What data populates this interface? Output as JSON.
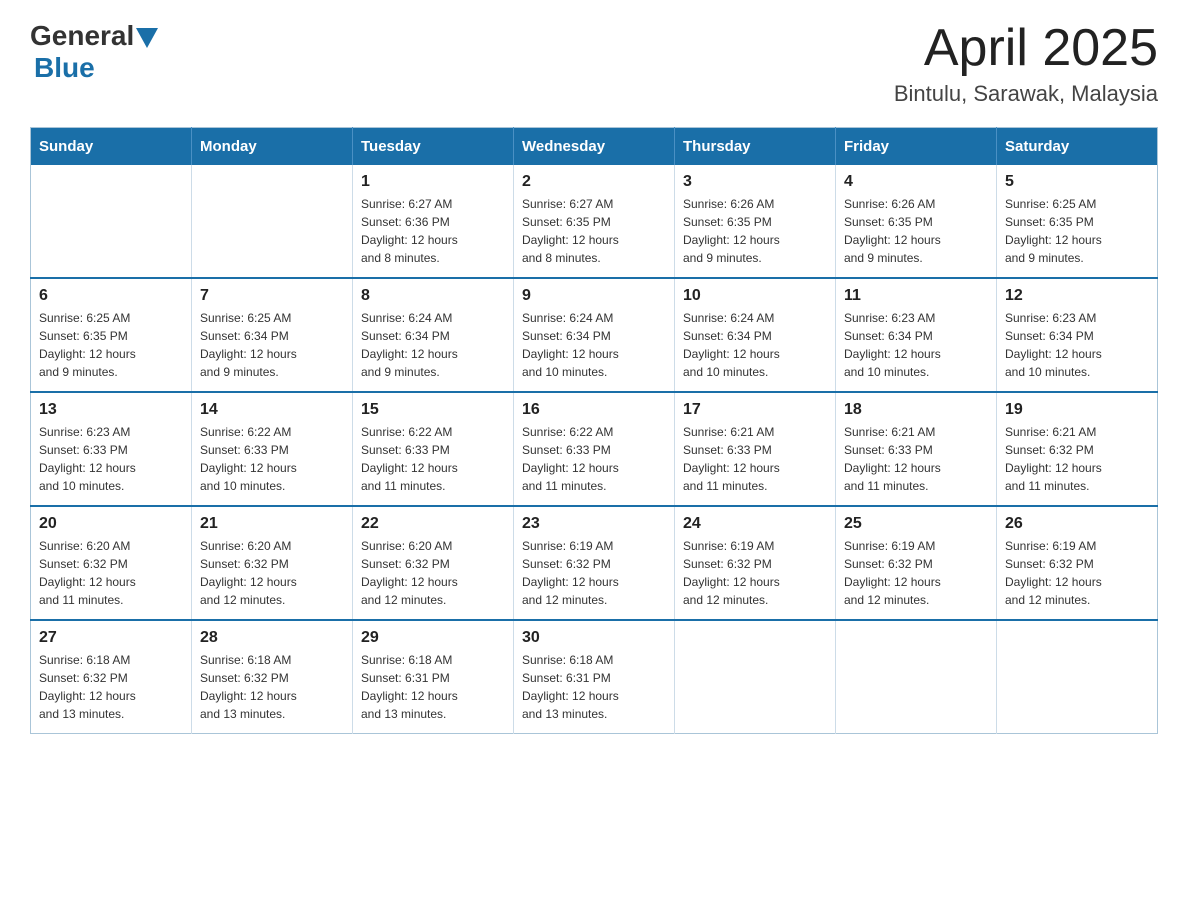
{
  "header": {
    "logo_general": "General",
    "logo_blue": "Blue",
    "title": "April 2025",
    "subtitle": "Bintulu, Sarawak, Malaysia"
  },
  "calendar": {
    "days_of_week": [
      "Sunday",
      "Monday",
      "Tuesday",
      "Wednesday",
      "Thursday",
      "Friday",
      "Saturday"
    ],
    "weeks": [
      [
        {
          "day": "",
          "info": ""
        },
        {
          "day": "",
          "info": ""
        },
        {
          "day": "1",
          "info": "Sunrise: 6:27 AM\nSunset: 6:36 PM\nDaylight: 12 hours\nand 8 minutes."
        },
        {
          "day": "2",
          "info": "Sunrise: 6:27 AM\nSunset: 6:35 PM\nDaylight: 12 hours\nand 8 minutes."
        },
        {
          "day": "3",
          "info": "Sunrise: 6:26 AM\nSunset: 6:35 PM\nDaylight: 12 hours\nand 9 minutes."
        },
        {
          "day": "4",
          "info": "Sunrise: 6:26 AM\nSunset: 6:35 PM\nDaylight: 12 hours\nand 9 minutes."
        },
        {
          "day": "5",
          "info": "Sunrise: 6:25 AM\nSunset: 6:35 PM\nDaylight: 12 hours\nand 9 minutes."
        }
      ],
      [
        {
          "day": "6",
          "info": "Sunrise: 6:25 AM\nSunset: 6:35 PM\nDaylight: 12 hours\nand 9 minutes."
        },
        {
          "day": "7",
          "info": "Sunrise: 6:25 AM\nSunset: 6:34 PM\nDaylight: 12 hours\nand 9 minutes."
        },
        {
          "day": "8",
          "info": "Sunrise: 6:24 AM\nSunset: 6:34 PM\nDaylight: 12 hours\nand 9 minutes."
        },
        {
          "day": "9",
          "info": "Sunrise: 6:24 AM\nSunset: 6:34 PM\nDaylight: 12 hours\nand 10 minutes."
        },
        {
          "day": "10",
          "info": "Sunrise: 6:24 AM\nSunset: 6:34 PM\nDaylight: 12 hours\nand 10 minutes."
        },
        {
          "day": "11",
          "info": "Sunrise: 6:23 AM\nSunset: 6:34 PM\nDaylight: 12 hours\nand 10 minutes."
        },
        {
          "day": "12",
          "info": "Sunrise: 6:23 AM\nSunset: 6:34 PM\nDaylight: 12 hours\nand 10 minutes."
        }
      ],
      [
        {
          "day": "13",
          "info": "Sunrise: 6:23 AM\nSunset: 6:33 PM\nDaylight: 12 hours\nand 10 minutes."
        },
        {
          "day": "14",
          "info": "Sunrise: 6:22 AM\nSunset: 6:33 PM\nDaylight: 12 hours\nand 10 minutes."
        },
        {
          "day": "15",
          "info": "Sunrise: 6:22 AM\nSunset: 6:33 PM\nDaylight: 12 hours\nand 11 minutes."
        },
        {
          "day": "16",
          "info": "Sunrise: 6:22 AM\nSunset: 6:33 PM\nDaylight: 12 hours\nand 11 minutes."
        },
        {
          "day": "17",
          "info": "Sunrise: 6:21 AM\nSunset: 6:33 PM\nDaylight: 12 hours\nand 11 minutes."
        },
        {
          "day": "18",
          "info": "Sunrise: 6:21 AM\nSunset: 6:33 PM\nDaylight: 12 hours\nand 11 minutes."
        },
        {
          "day": "19",
          "info": "Sunrise: 6:21 AM\nSunset: 6:32 PM\nDaylight: 12 hours\nand 11 minutes."
        }
      ],
      [
        {
          "day": "20",
          "info": "Sunrise: 6:20 AM\nSunset: 6:32 PM\nDaylight: 12 hours\nand 11 minutes."
        },
        {
          "day": "21",
          "info": "Sunrise: 6:20 AM\nSunset: 6:32 PM\nDaylight: 12 hours\nand 12 minutes."
        },
        {
          "day": "22",
          "info": "Sunrise: 6:20 AM\nSunset: 6:32 PM\nDaylight: 12 hours\nand 12 minutes."
        },
        {
          "day": "23",
          "info": "Sunrise: 6:19 AM\nSunset: 6:32 PM\nDaylight: 12 hours\nand 12 minutes."
        },
        {
          "day": "24",
          "info": "Sunrise: 6:19 AM\nSunset: 6:32 PM\nDaylight: 12 hours\nand 12 minutes."
        },
        {
          "day": "25",
          "info": "Sunrise: 6:19 AM\nSunset: 6:32 PM\nDaylight: 12 hours\nand 12 minutes."
        },
        {
          "day": "26",
          "info": "Sunrise: 6:19 AM\nSunset: 6:32 PM\nDaylight: 12 hours\nand 12 minutes."
        }
      ],
      [
        {
          "day": "27",
          "info": "Sunrise: 6:18 AM\nSunset: 6:32 PM\nDaylight: 12 hours\nand 13 minutes."
        },
        {
          "day": "28",
          "info": "Sunrise: 6:18 AM\nSunset: 6:32 PM\nDaylight: 12 hours\nand 13 minutes."
        },
        {
          "day": "29",
          "info": "Sunrise: 6:18 AM\nSunset: 6:31 PM\nDaylight: 12 hours\nand 13 minutes."
        },
        {
          "day": "30",
          "info": "Sunrise: 6:18 AM\nSunset: 6:31 PM\nDaylight: 12 hours\nand 13 minutes."
        },
        {
          "day": "",
          "info": ""
        },
        {
          "day": "",
          "info": ""
        },
        {
          "day": "",
          "info": ""
        }
      ]
    ]
  }
}
